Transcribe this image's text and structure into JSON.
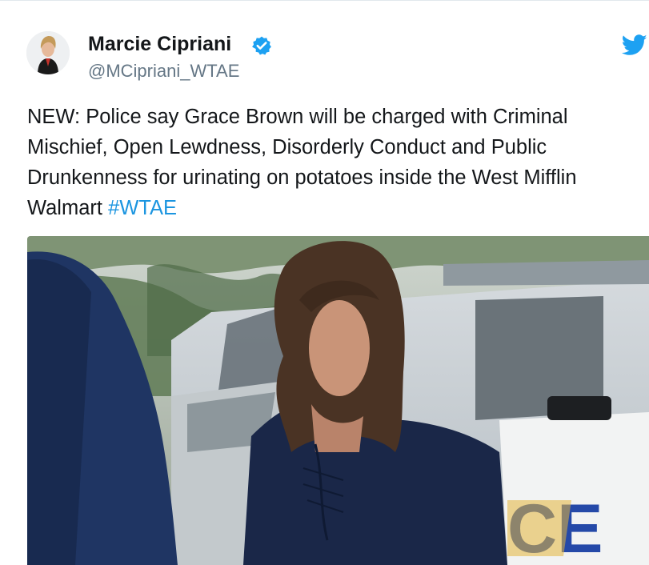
{
  "tweet": {
    "author_name": "Marcie Cipriani",
    "author_handle": "@MCipriani_WTAE",
    "text": "NEW: Police say Grace Brown will be charged with Criminal Mischief, Open Lewdness, Disorderly Conduct and Public Drunkenness for urinating on potatoes inside the West Mifflin Walmart",
    "hashtag": "#WTAE",
    "verified": true
  },
  "media": {
    "vehicle_lettering": "CE"
  },
  "icons": {
    "brand": "twitter-bird-icon",
    "badge": "verified-badge-icon"
  },
  "colors": {
    "twitter_blue": "#1da1f2",
    "hashtag": "#1b95e0",
    "text": "#14171a",
    "handle": "#657786"
  }
}
